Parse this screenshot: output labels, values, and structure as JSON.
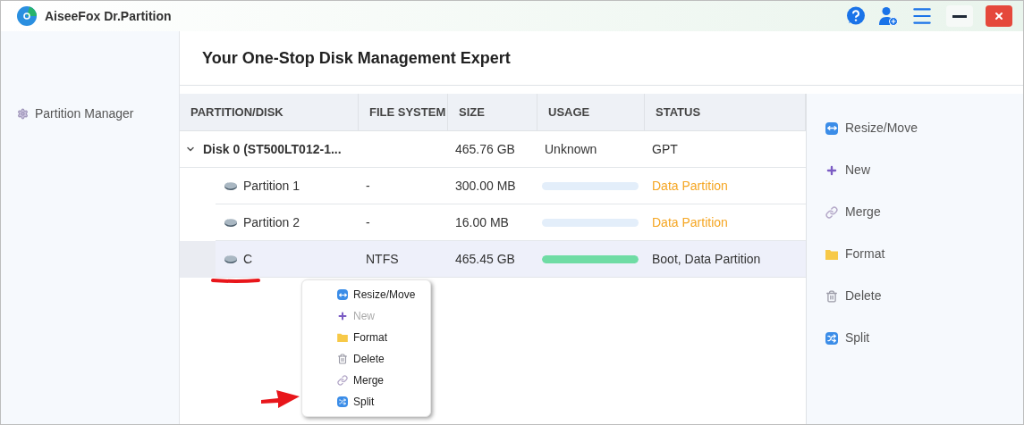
{
  "app": {
    "title": "AiseeFox Dr.Partition"
  },
  "sidebar": {
    "items": [
      {
        "label": "Partition Manager"
      }
    ]
  },
  "header": {
    "title": "Your One-Stop Disk Management Expert"
  },
  "table": {
    "columns": [
      "PARTITION/DISK",
      "FILE SYSTEM",
      "SIZE",
      "USAGE",
      "STATUS"
    ],
    "rows": [
      {
        "name": "Disk 0 (ST500LT012-1...",
        "size": "465.76 GB",
        "usage": "Unknown",
        "status": "GPT",
        "expanded": true,
        "children": [
          {
            "name": "Partition 1",
            "file_system": "-",
            "size": "300.00 MB",
            "usage": {
              "level": 0
            },
            "status": "Data Partition",
            "color": "#f5a623",
            "selected": false
          },
          {
            "name": "Partition 2",
            "file_system": "-",
            "size": "16.00 MB",
            "usage": {
              "level": 0
            },
            "status": "Data Partition",
            "color": "#f5a623",
            "selected": false
          },
          {
            "name": "C",
            "file_system": "NTFS",
            "size": "465.45 GB",
            "usage": {
              "level": 1
            },
            "status": "Boot, Data Partition",
            "color": "#333333",
            "selected": true
          }
        ]
      }
    ]
  },
  "actions": [
    {
      "kind": "resize",
      "label": "Resize/Move"
    },
    {
      "kind": "new",
      "label": "New"
    },
    {
      "kind": "merge",
      "label": "Merge"
    },
    {
      "kind": "format",
      "label": "Format"
    },
    {
      "kind": "delete",
      "label": "Delete"
    },
    {
      "kind": "split",
      "label": "Split"
    }
  ],
  "context_menu": {
    "items": [
      {
        "kind": "resize",
        "label": "Resize/Move",
        "disabled": false
      },
      {
        "kind": "new",
        "label": "New",
        "disabled": true
      },
      {
        "kind": "format",
        "label": "Format",
        "disabled": false
      },
      {
        "kind": "delete",
        "label": "Delete",
        "disabled": false
      },
      {
        "kind": "merge",
        "label": "Merge",
        "disabled": false
      },
      {
        "kind": "split",
        "label": "Split",
        "disabled": false
      }
    ]
  }
}
